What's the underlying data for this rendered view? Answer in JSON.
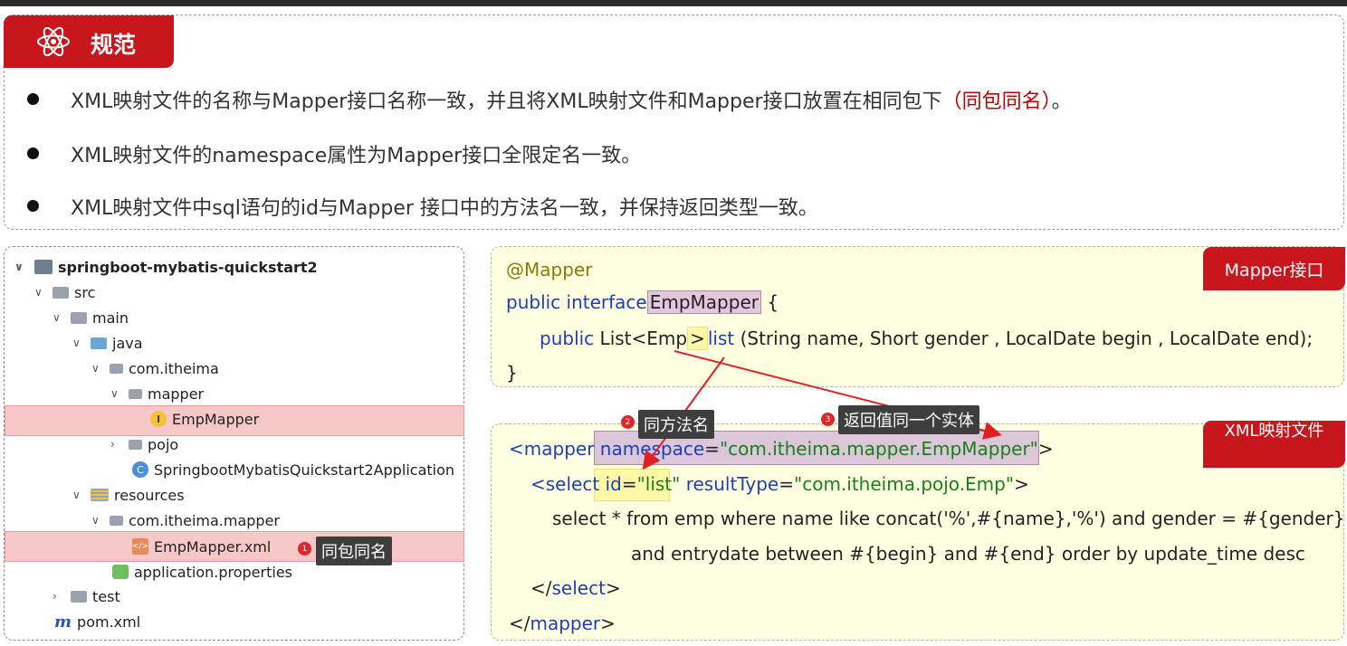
{
  "header": {
    "title": "规范"
  },
  "rules": [
    {
      "text": "XML映射文件的名称与Mapper接口名称一致，并且将XML映射文件和Mapper接口放置在相同包下",
      "highlight": "（同包同名）",
      "tail": "。"
    },
    {
      "text": "XML映射文件的namespace属性为Mapper接口全限定名一致。"
    },
    {
      "text": "XML映射文件中sql语句的id与Mapper 接口中的方法名一致，并保持返回类型一致。"
    }
  ],
  "tree": {
    "items": [
      {
        "label": "springboot-mybatis-quickstart2"
      },
      {
        "label": "src"
      },
      {
        "label": "main"
      },
      {
        "label": "java"
      },
      {
        "label": "com.itheima"
      },
      {
        "label": "mapper"
      },
      {
        "label": "EmpMapper"
      },
      {
        "label": "pojo"
      },
      {
        "label": "SpringbootMybatisQuickstart2Application"
      },
      {
        "label": "resources"
      },
      {
        "label": "com.itheima.mapper"
      },
      {
        "label": "EmpMapper.xml"
      },
      {
        "label": "application.properties"
      },
      {
        "label": "test"
      },
      {
        "label": "pom.xml"
      }
    ]
  },
  "callouts": {
    "c1": {
      "num": "1",
      "text": "同包同名"
    },
    "c2": {
      "num": "2",
      "text": "同方法名"
    },
    "c3": {
      "num": "3",
      "text": "返回值同一个实体"
    }
  },
  "mapper_code": {
    "tab": "Mapper接口",
    "annotation": "@Mapper",
    "l2_kw": "public interface",
    "l2_name": "EmpMapper",
    "l2_brace": " {",
    "l3_kw": "public",
    "l3_type": " List<Emp",
    "l3_gt": ">",
    "l3_method": "list",
    "l3_params": " (String name, Short gender , LocalDate begin , LocalDate end);",
    "l4": "}"
  },
  "xml_code": {
    "tab": "XML映射文件",
    "l1_open": "<mapper",
    "l1_attr": "namespace",
    "l1_eq": "=",
    "l1_val": "\"com.itheima.mapper.EmpMapper\"",
    "l1_close": ">",
    "l2_open": "<select",
    "l2_id": "id",
    "l2_eq": "=",
    "l2_idval": "\"list\"",
    "l2_rt": " resultType",
    "l2_rteq": "=",
    "l2_rtval": "\"com.itheima.pojo.Emp\"",
    "l2_close": ">",
    "l3": "select * from emp where name like concat('%',#{name},'%') and gender = #{gender}",
    "l4": "and entrydate between #{begin} and #{end} order by update_time desc",
    "l5_open": "</",
    "l5_tag": "select",
    "l5_close": ">",
    "l6_open": "</",
    "l6_tag": "mapper",
    "l6_close": ">"
  }
}
